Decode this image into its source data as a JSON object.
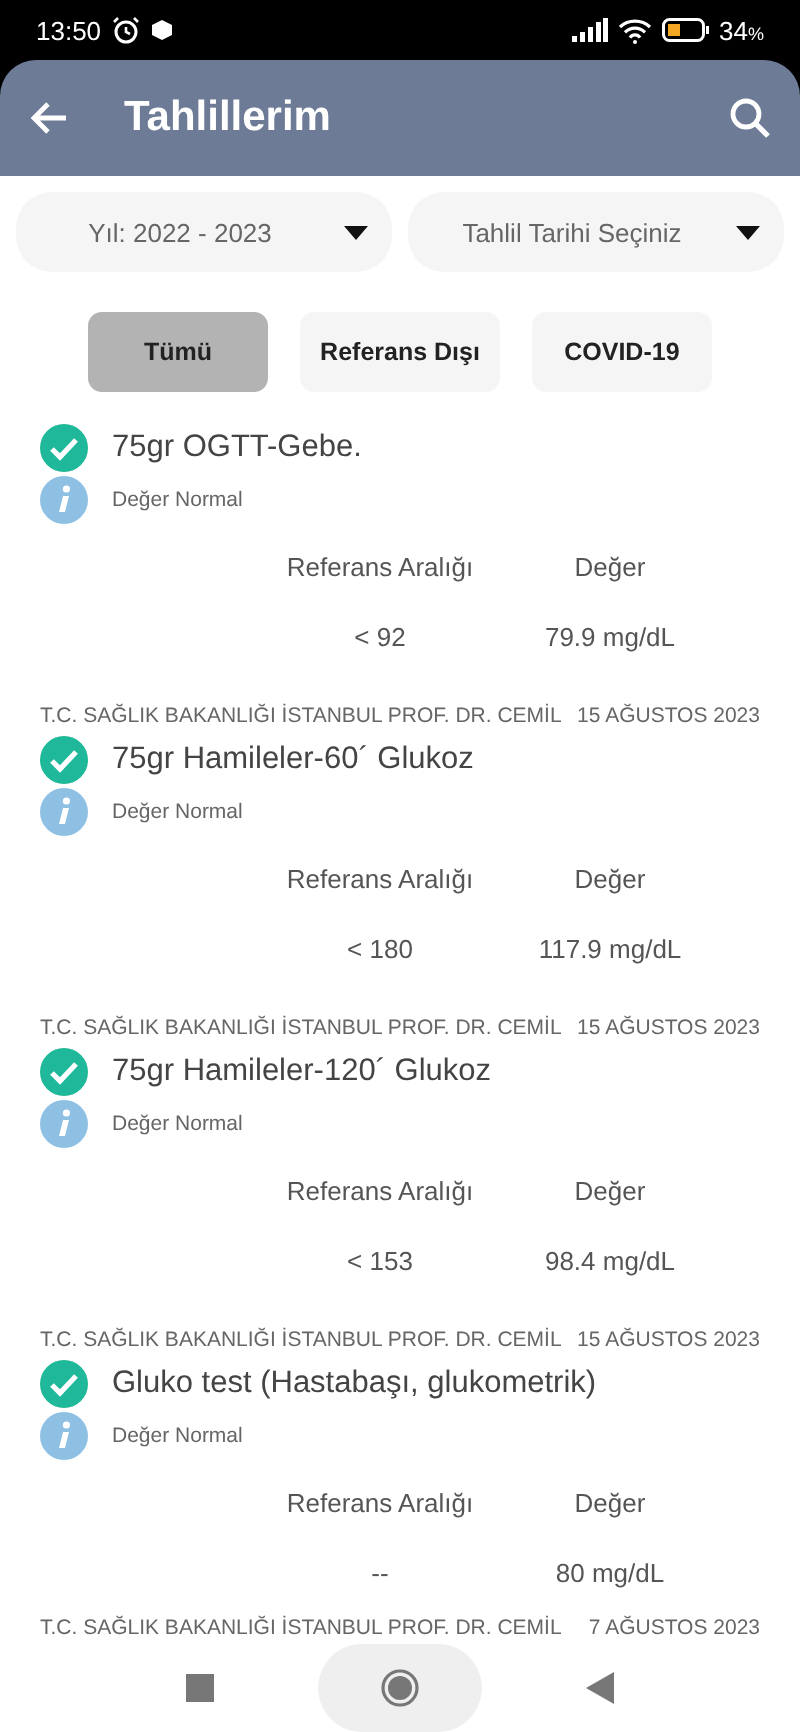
{
  "status_bar": {
    "time": "13:50",
    "battery": "34",
    "battery_unit": "%"
  },
  "header": {
    "title": "Tahlillerim"
  },
  "filters": [
    {
      "label": "Yıl: 2022 - 2023"
    },
    {
      "label": "Tahlil Tarihi Seçiniz"
    }
  ],
  "chips": [
    {
      "label": "Tümü",
      "selected": true
    },
    {
      "label": "Referans Dışı",
      "selected": false
    },
    {
      "label": "COVID-19",
      "selected": false
    }
  ],
  "results": [
    {
      "name": "75gr OGTT-Gebe.",
      "status": "Değer Normal",
      "range_label": "Referans Aralığı",
      "value_label": "Değer",
      "range": "< 92",
      "value": "79.9 mg/dL"
    },
    {
      "hospital": "T.C. SAĞLIK BAKANLIĞI İSTANBUL PROF. DR. CEMİL",
      "date": "15 AĞUSTOS 2023",
      "name": "75gr Hamileler-60´ Glukoz",
      "status": "Değer Normal",
      "range_label": "Referans Aralığı",
      "value_label": "Değer",
      "range": "< 180",
      "value": "117.9 mg/dL"
    },
    {
      "hospital": "T.C. SAĞLIK BAKANLIĞI İSTANBUL PROF. DR. CEMİL",
      "date": "15 AĞUSTOS 2023",
      "name": "75gr Hamileler-120´ Glukoz",
      "status": "Değer Normal",
      "range_label": "Referans Aralığı",
      "value_label": "Değer",
      "range": "< 153",
      "value": "98.4 mg/dL"
    },
    {
      "hospital": "T.C. SAĞLIK BAKANLIĞI İSTANBUL PROF. DR. CEMİL",
      "date": "15 AĞUSTOS 2023",
      "name": "Gluko test (Hastabaşı, glukometrik)",
      "status": "Değer Normal",
      "range_label": "Referans Aralığı",
      "value_label": "Değer",
      "range": "--",
      "value": "80 mg/dL"
    }
  ],
  "next_hospital": "T.C. SAĞLIK BAKANLIĞI İSTANBUL PROF. DR. CEMİL",
  "next_date": "7 AĞUSTOS 2023"
}
